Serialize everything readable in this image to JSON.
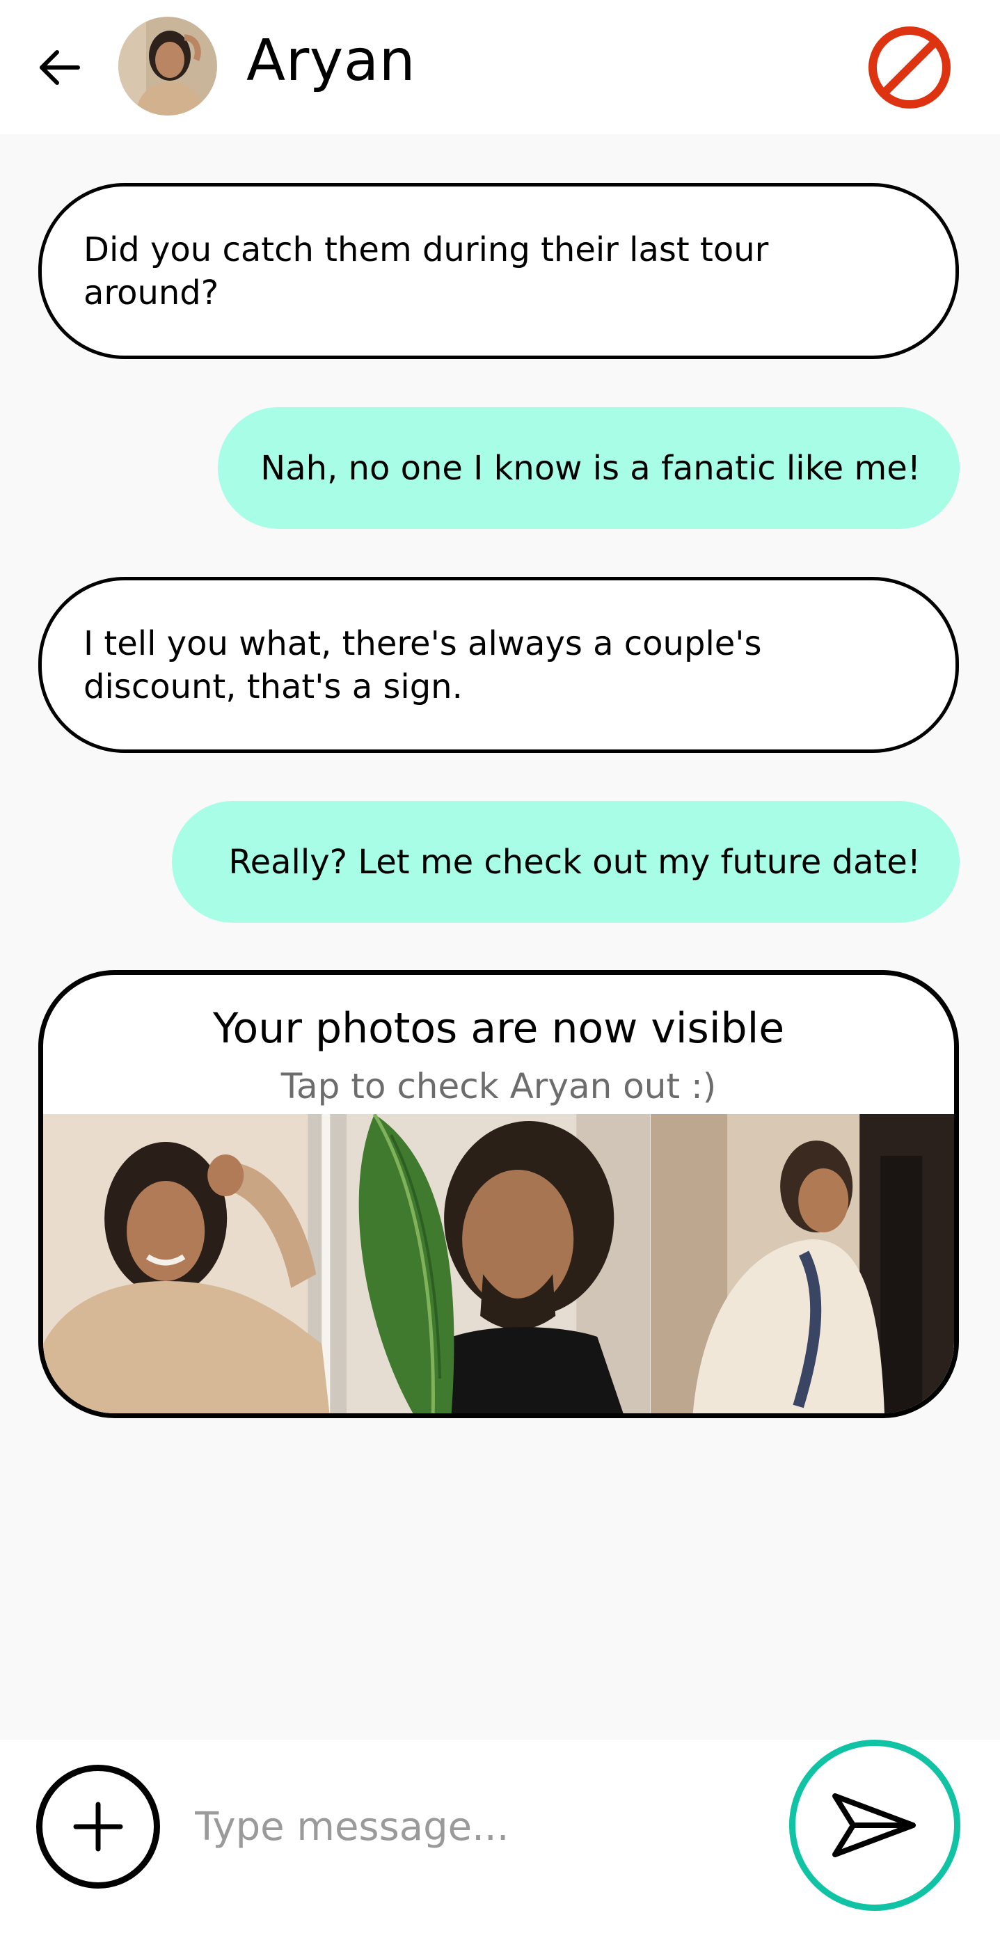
{
  "header": {
    "contact_name": "Aryan",
    "back_icon": "arrow-left-icon",
    "block_icon": "block-icon",
    "block_color": "#dd3311"
  },
  "messages": [
    {
      "direction": "incoming",
      "text": "Did you catch them during their last tour around?"
    },
    {
      "direction": "outgoing",
      "text": "Nah, no one I know is a fanatic like me!"
    },
    {
      "direction": "incoming",
      "text": "I tell you what, there's always a couple's discount, that's a sign."
    },
    {
      "direction": "outgoing",
      "text": "Really? Let me check out my future date!"
    }
  ],
  "photo_card": {
    "title": "Your photos are now visible",
    "subtitle": "Tap to check Aryan out :)",
    "photos": [
      "photo-beige-sweater",
      "photo-leaf-portrait",
      "photo-side-profile"
    ]
  },
  "composer": {
    "placeholder": "Type message...",
    "add_icon": "plus-icon",
    "send_icon": "send-icon",
    "send_accent": "#10c3a5"
  },
  "colors": {
    "outgoing_bubble": "#a8fde6",
    "background": "#f9f9f9"
  }
}
